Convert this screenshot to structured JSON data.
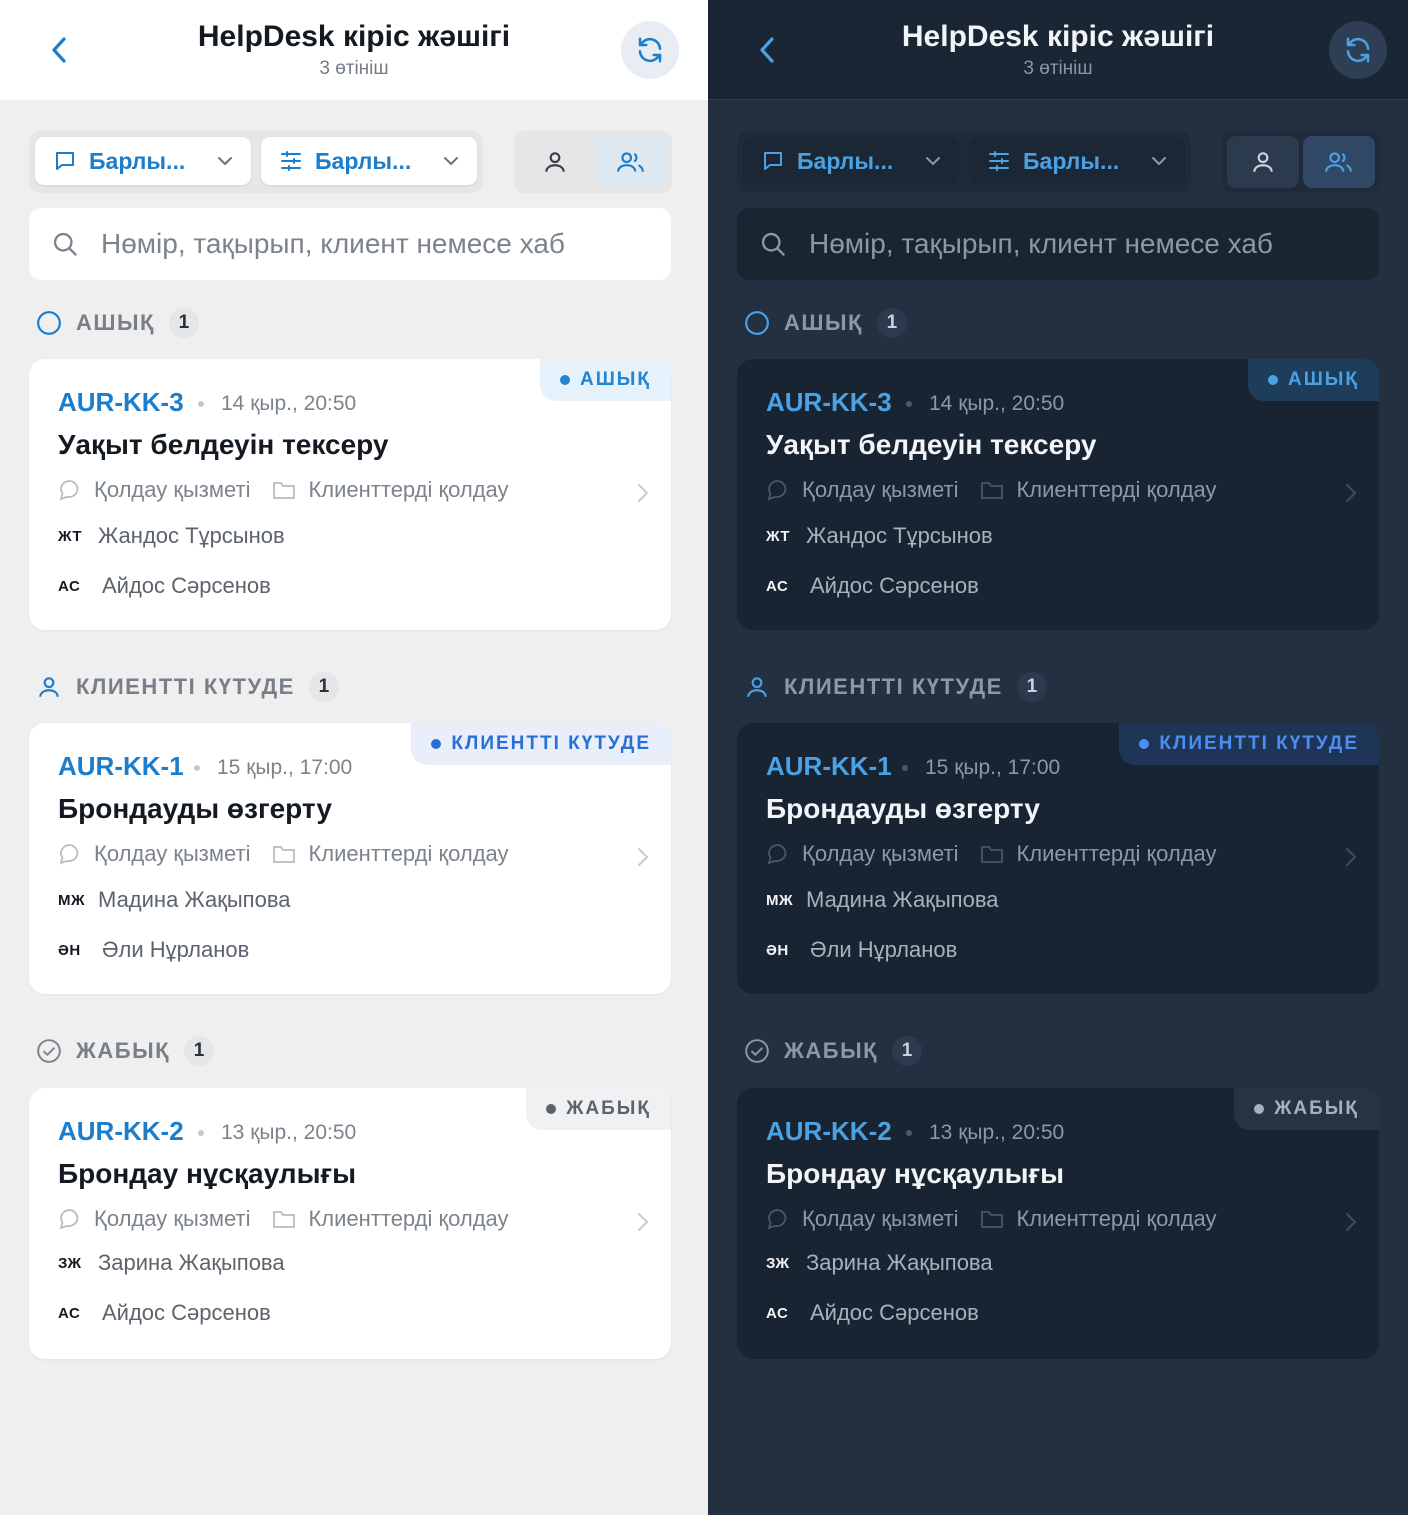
{
  "header": {
    "title": "HelpDesk кіріс жәшігі",
    "subtitle": "3 өтініш"
  },
  "filters": {
    "type_label": "Барлы...",
    "settings_label": "Барлы..."
  },
  "search": {
    "placeholder": "Нөмір, тақырып, клиент немесе хаб"
  },
  "sections": [
    {
      "title": "АШЫҚ",
      "count": "1",
      "ticket": {
        "badge": "АШЫҚ",
        "id": "AUR-KK-3",
        "date": "14 қыр., 20:50",
        "title": "Уақыт белдеуін тексеру",
        "channel": "Қолдау қызметі",
        "queue": "Клиенттерді қолдау",
        "requester_initials": "ЖТ",
        "requester": "Жандос Тұрсынов",
        "assignee_initials": "АС",
        "assignee": "Айдос Сәрсенов"
      }
    },
    {
      "title": "КЛИЕНТТІ КҮТУДЕ",
      "count": "1",
      "ticket": {
        "badge": "КЛИЕНТТІ КҮТУДЕ",
        "id": "AUR-KK-1",
        "date": "15 қыр., 17:00",
        "title": "Брондауды өзгерту",
        "channel": "Қолдау қызметі",
        "queue": "Клиенттерді қолдау",
        "requester_initials": "МЖ",
        "requester": "Мадина Жақыпова",
        "assignee_initials": "ӘН",
        "assignee": "Әли Нұрланов"
      }
    },
    {
      "title": "ЖАБЫҚ",
      "count": "1",
      "ticket": {
        "badge": "ЖАБЫҚ",
        "id": "AUR-KK-2",
        "date": "13 қыр., 20:50",
        "title": "Брондау нұсқаулығы",
        "channel": "Қолдау қызметі",
        "queue": "Клиенттерді қолдау",
        "requester_initials": "ЗЖ",
        "requester": "Зарина Жақыпова",
        "assignee_initials": "АС",
        "assignee": "Айдос Сәрсенов"
      }
    }
  ],
  "icons": {
    "back": "chevron-left-icon",
    "refresh": "refresh-icon",
    "chat_filter": "chat-bubble-icon",
    "sliders": "sliders-icon",
    "single_user": "user-icon",
    "multi_user": "users-icon",
    "search": "search-icon",
    "open": "circle-icon",
    "waiting": "user-icon",
    "closed": "check-circle-icon",
    "channel": "chat-bubble-icon",
    "queue": "folder-icon"
  },
  "colors": {
    "accent_light": "#1c7dcb",
    "accent_dark": "#4aa2e4",
    "waiting_badge_light": "#2a6fd6",
    "waiting_badge_dark": "#4c8df0",
    "light_background": "#efeff0",
    "dark_background": "#223042"
  }
}
